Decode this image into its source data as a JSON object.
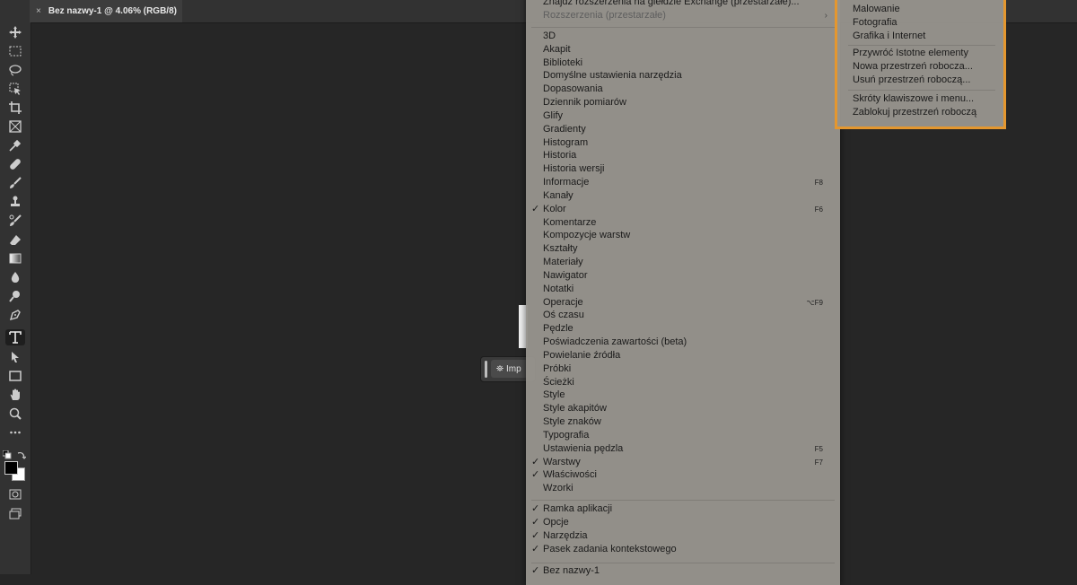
{
  "document_tab": {
    "close": "×",
    "title": "Bez nazwy-1 @ 4.06% (RGB/8)"
  },
  "context_bar": {
    "button_label": "Imp"
  },
  "menu": {
    "top_items": [
      {
        "label": "Znajdź rozszerzenia na giełdzie Exchange (przestarzałe)..."
      },
      {
        "label": "Rozszerzenia (przestarzałe)",
        "arrow": "›"
      }
    ],
    "panels": [
      {
        "label": "3D"
      },
      {
        "label": "Akapit"
      },
      {
        "label": "Biblioteki"
      },
      {
        "label": "Domyślne ustawienia narzędzia"
      },
      {
        "label": "Dopasowania"
      },
      {
        "label": "Dziennik pomiarów"
      },
      {
        "label": "Glify"
      },
      {
        "label": "Gradienty"
      },
      {
        "label": "Histogram"
      },
      {
        "label": "Historia"
      },
      {
        "label": "Historia wersji"
      },
      {
        "label": "Informacje",
        "shortcut": "F8"
      },
      {
        "label": "Kanały"
      },
      {
        "label": "Kolor",
        "check": "✓",
        "shortcut": "F6"
      },
      {
        "label": "Komentarze"
      },
      {
        "label": "Kompozycje warstw"
      },
      {
        "label": "Kształty"
      },
      {
        "label": "Materiały"
      },
      {
        "label": "Nawigator"
      },
      {
        "label": "Notatki"
      },
      {
        "label": "Operacje",
        "shortcut": "⌥F9"
      },
      {
        "label": "Oś czasu"
      },
      {
        "label": "Pędzle"
      },
      {
        "label": "Poświadczenia zawartości (beta)"
      },
      {
        "label": "Powielanie źródła"
      },
      {
        "label": "Próbki"
      },
      {
        "label": "Ścieżki"
      },
      {
        "label": "Style"
      },
      {
        "label": "Style akapitów"
      },
      {
        "label": "Style znaków"
      },
      {
        "label": "Typografia"
      },
      {
        "label": "Ustawienia pędzla",
        "shortcut": "F5"
      },
      {
        "label": "Warstwy",
        "check": "✓",
        "shortcut": "F7"
      },
      {
        "label": "Właściwości",
        "check": "✓"
      },
      {
        "label": "Wzorki"
      }
    ],
    "frame_items": [
      {
        "label": "Ramka aplikacji",
        "check": "✓"
      },
      {
        "label": "Opcje",
        "check": "✓"
      },
      {
        "label": "Narzędzia",
        "check": "✓"
      },
      {
        "label": "Pasek zadania kontekstowego",
        "check": "✓"
      }
    ],
    "document_items": [
      {
        "label": "Bez nazwy-1",
        "check": "✓"
      }
    ]
  },
  "workspace_submenu": {
    "group1": [
      "Malowanie",
      "Fotografia",
      "Grafika i Internet"
    ],
    "group2": [
      "Przywróć Istotne elementy",
      "Nowa przestrzeń robocza...",
      "Usuń przestrzeń roboczą..."
    ],
    "group3": [
      "Skróty klawiszowe i menu...",
      "Zablokuj przestrzeń roboczą"
    ]
  },
  "toolbar": {
    "tools": [
      "move-tool-icon",
      "marquee-tool-icon",
      "lasso-tool-icon",
      "object-select-tool-icon",
      "crop-tool-icon",
      "frame-tool-icon",
      "eyedropper-tool-icon",
      "healing-brush-tool-icon",
      "brush-tool-icon",
      "clone-stamp-tool-icon",
      "history-brush-tool-icon",
      "eraser-tool-icon",
      "gradient-tool-icon",
      "blur-tool-icon",
      "dodge-tool-icon",
      "pen-tool-icon",
      "type-tool-icon",
      "path-selection-tool-icon",
      "rectangle-tool-icon",
      "hand-tool-icon",
      "zoom-tool-icon",
      "more-tools-icon"
    ],
    "active_tool": "type-tool-icon"
  },
  "colors": {
    "menu_bg": "#96938c",
    "submenu_highlight": "#e4972f",
    "canvas": "#262626"
  }
}
